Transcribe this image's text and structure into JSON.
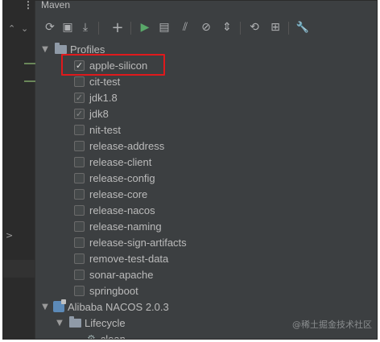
{
  "panel": {
    "title": "Maven",
    "menu_icon": "vertical-dots-icon"
  },
  "toolbar": {
    "buttons": [
      {
        "name": "reload-icon",
        "glyph": "⟳"
      },
      {
        "name": "add-folder-icon",
        "glyph": "▣"
      },
      {
        "name": "download-icon",
        "glyph": "⤓"
      },
      {
        "name": "add-icon",
        "glyph": "+"
      },
      {
        "name": "run-icon",
        "glyph": "▶",
        "color": "#59a869"
      },
      {
        "name": "run-config-icon",
        "glyph": "▤"
      },
      {
        "name": "toggle-offline-icon",
        "glyph": "⫽"
      },
      {
        "name": "skip-tests-icon",
        "glyph": "⊘"
      },
      {
        "name": "collapse-icon",
        "glyph": "⇕"
      },
      {
        "name": "dependencies-icon",
        "glyph": "⟲"
      },
      {
        "name": "align-icon",
        "glyph": "⊞"
      },
      {
        "name": "settings-wrench-icon",
        "glyph": "🔧"
      }
    ]
  },
  "tree": {
    "profiles_label": "Profiles",
    "profiles": [
      {
        "label": "apple-silicon",
        "checked": true
      },
      {
        "label": "cit-test",
        "checked": false
      },
      {
        "label": "jdk1.8",
        "checked": true
      },
      {
        "label": "jdk8",
        "checked": true
      },
      {
        "label": "nit-test",
        "checked": false
      },
      {
        "label": "release-address",
        "checked": false
      },
      {
        "label": "release-client",
        "checked": false
      },
      {
        "label": "release-config",
        "checked": false
      },
      {
        "label": "release-core",
        "checked": false
      },
      {
        "label": "release-nacos",
        "checked": false
      },
      {
        "label": "release-naming",
        "checked": false
      },
      {
        "label": "release-sign-artifacts",
        "checked": false
      },
      {
        "label": "remove-test-data",
        "checked": false
      },
      {
        "label": "sonar-apache",
        "checked": false
      },
      {
        "label": "springboot",
        "checked": false
      }
    ],
    "project_label": "Alibaba NACOS 2.0.3",
    "lifecycle_label": "Lifecycle",
    "clean_label": "clean"
  },
  "colors": {
    "highlight": "#e0191c",
    "background": "#3c3f41"
  },
  "watermark": "@稀土掘金技术社区"
}
